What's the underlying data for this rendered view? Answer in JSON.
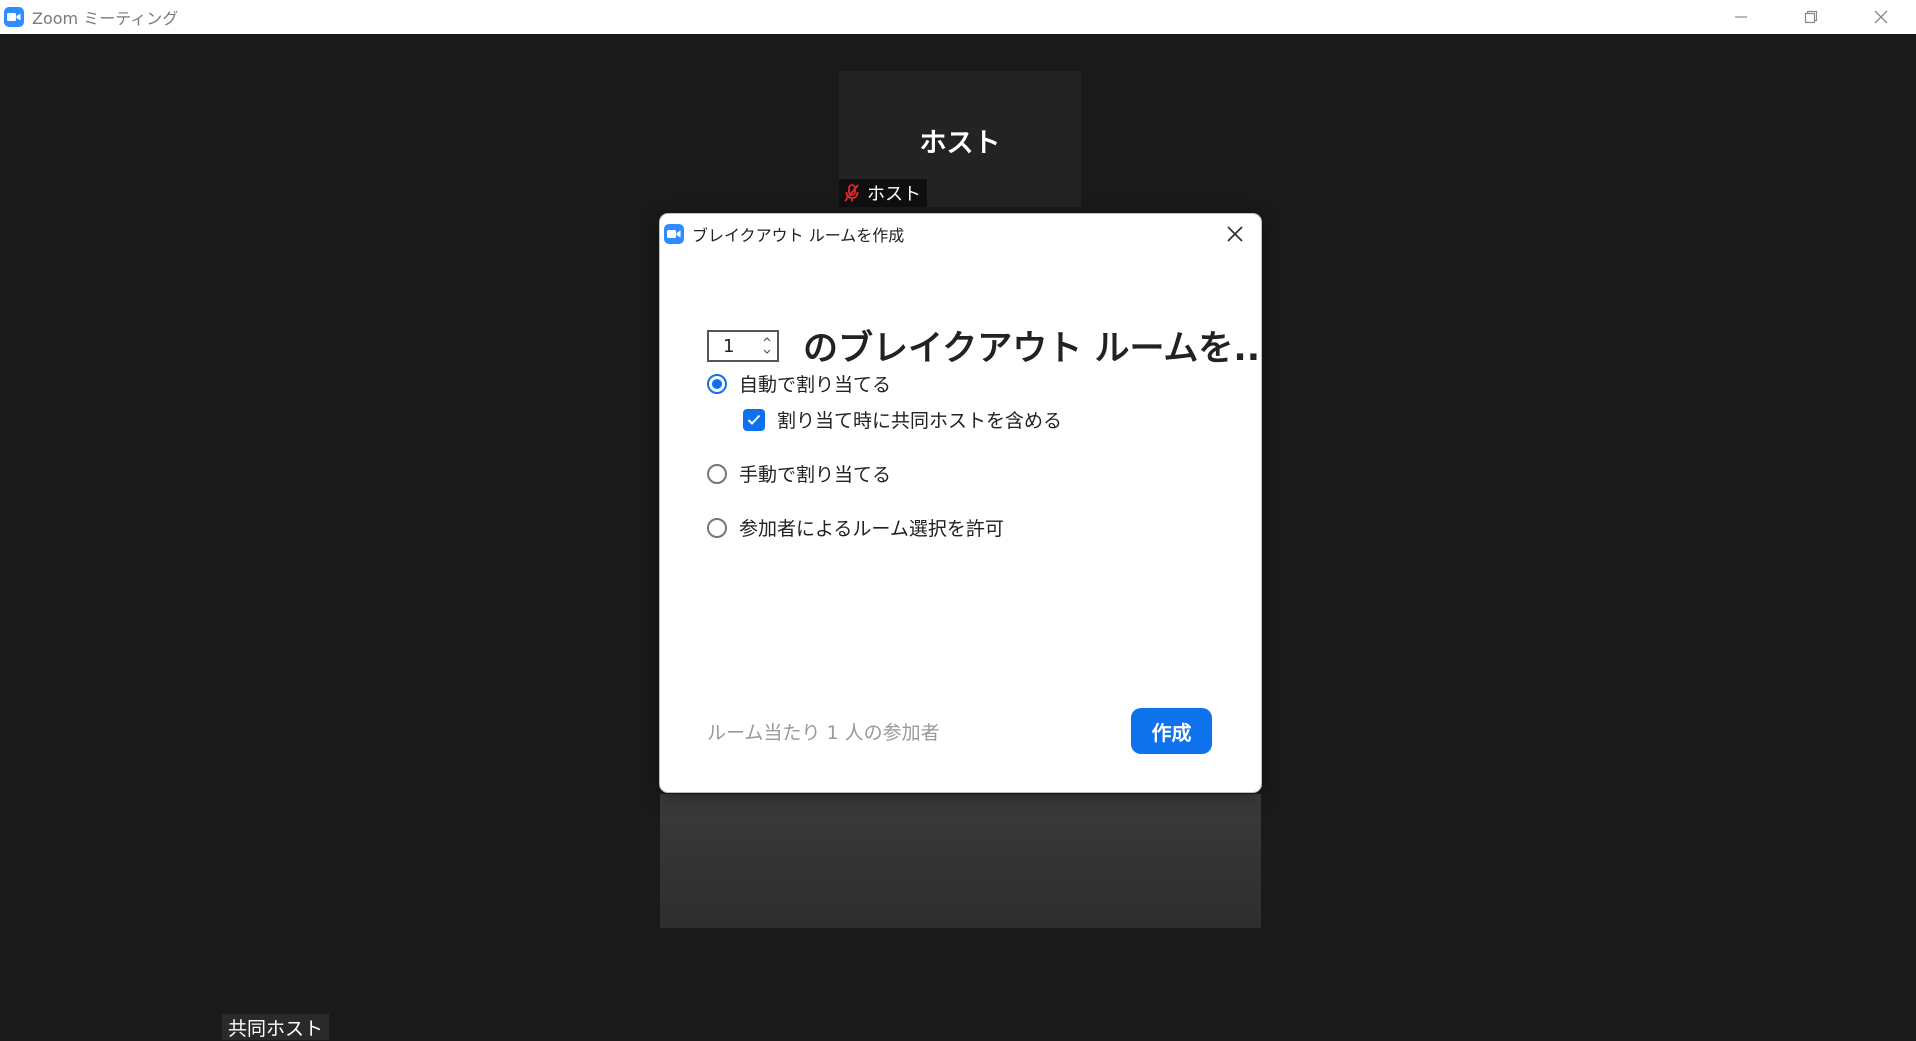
{
  "window": {
    "title": "Zoom ミーティング",
    "icon": "zoom-camera-icon",
    "controls": [
      "minimize-icon",
      "restore-icon",
      "close-icon"
    ]
  },
  "tiles": {
    "host_name": "ホスト",
    "host_label": "ホスト",
    "host_label_icon": "mic-muted-icon",
    "cohost_label": "共同ホスト"
  },
  "dialog": {
    "title": "ブレイクアウト ルームを作成",
    "room_count": "1",
    "count_suffix": "のブレイクアウト ルームを...",
    "options": {
      "auto": "自動で割り当てる",
      "include_cohost": "割り当て時に共同ホストを含める",
      "manual": "手動で割り当てる",
      "self_select": "参加者によるルーム選択を許可"
    },
    "selected_option": "auto",
    "include_cohost_checked": true,
    "footer_text": "ルーム当たり 1 人の参加者",
    "create_button": "作成"
  },
  "colors": {
    "accent": "#0e72ed",
    "background": "#1a1a1a",
    "muted_red": "#e02828"
  }
}
